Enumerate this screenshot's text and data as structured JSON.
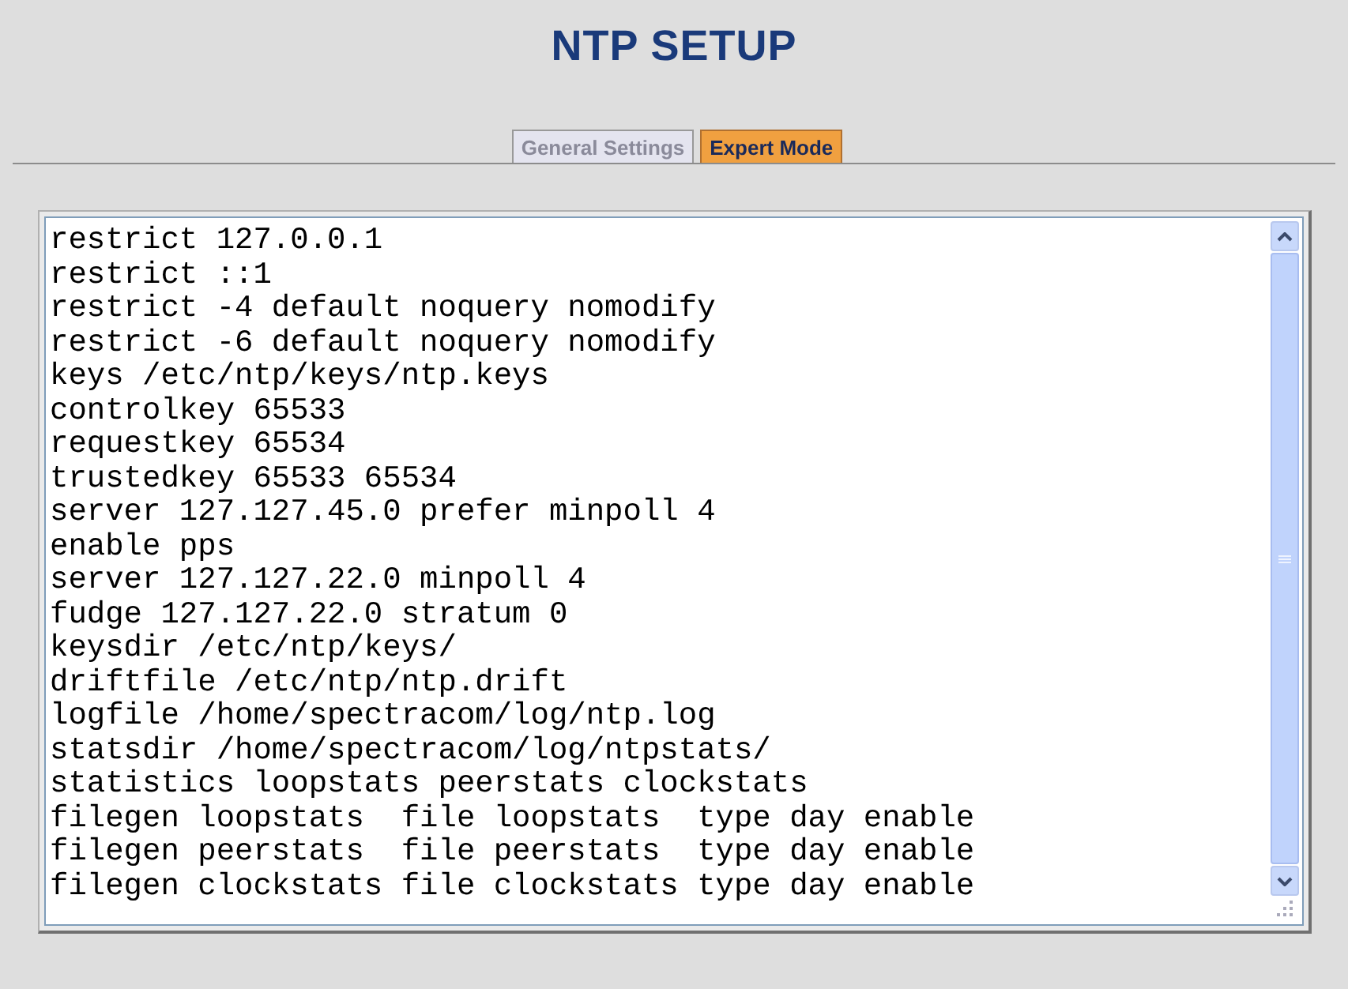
{
  "title": "NTP SETUP",
  "tabs": [
    {
      "label": "General Settings",
      "selected": false
    },
    {
      "label": "Expert Mode",
      "selected": true
    }
  ],
  "config_editor": {
    "lines": [
      "restrict 127.0.0.1",
      "restrict ::1",
      "restrict -4 default noquery nomodify",
      "restrict -6 default noquery nomodify",
      "keys /etc/ntp/keys/ntp.keys",
      "controlkey 65533",
      "requestkey 65534",
      "trustedkey 65533 65534",
      "server 127.127.45.0 prefer minpoll 4",
      "enable pps",
      "server 127.127.22.0 minpoll 4",
      "fudge 127.127.22.0 stratum 0",
      "keysdir /etc/ntp/keys/",
      "driftfile /etc/ntp/ntp.drift",
      "logfile /home/spectracom/log/ntp.log",
      "statsdir /home/spectracom/log/ntpstats/",
      "statistics loopstats peerstats clockstats",
      "filegen loopstats  file loopstats  type day enable",
      "filegen peerstats  file peerstats  type day enable",
      "filegen clockstats file clockstats type day enable"
    ]
  }
}
